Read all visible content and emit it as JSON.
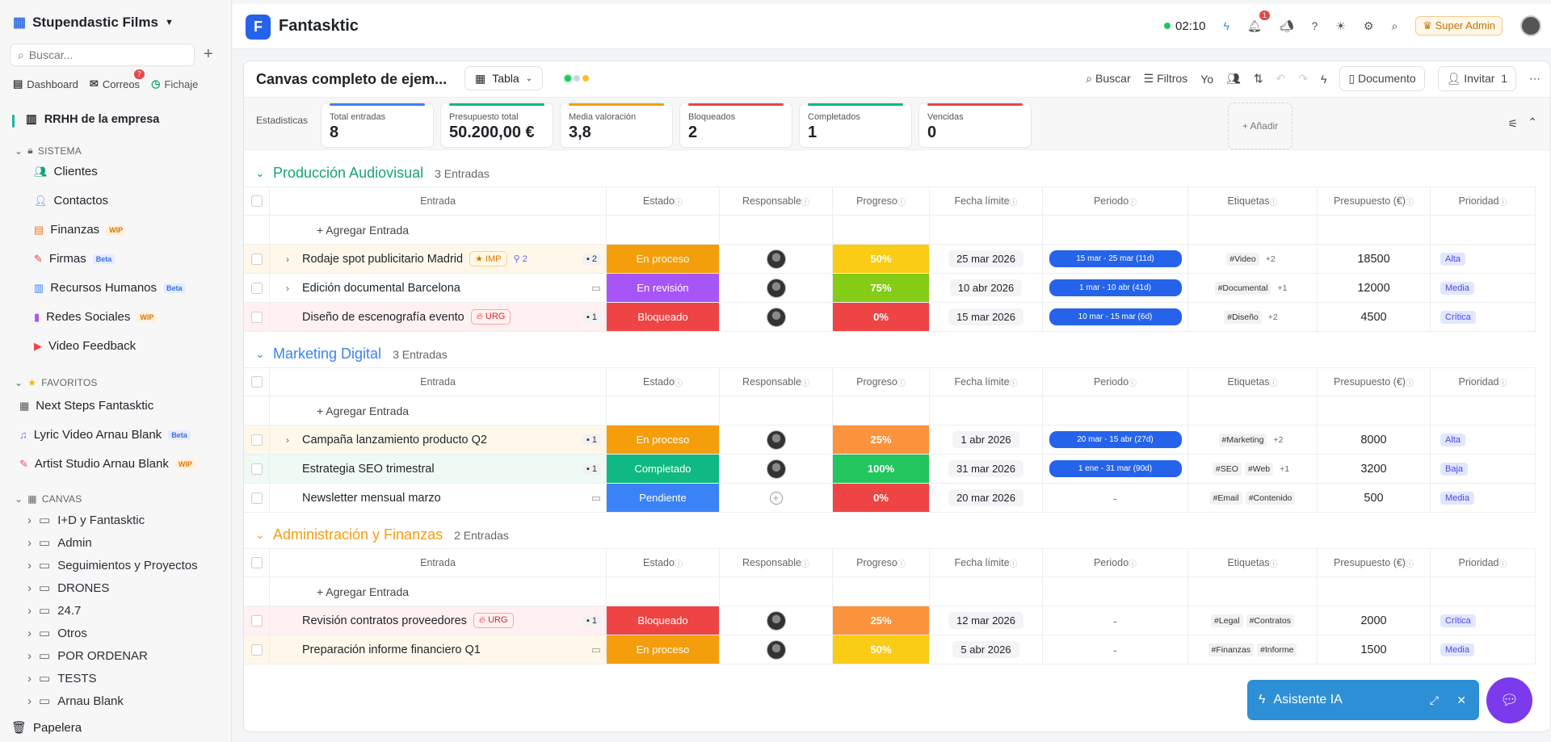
{
  "sidebar": {
    "workspace": "Stupendastic Films",
    "search_placeholder": "Buscar...",
    "quick": [
      "Dashboard",
      "Correos",
      "Fichaje"
    ],
    "correos_badge": "7",
    "current": "RRHH de la empresa",
    "sistema_label": "SISTEMA",
    "sistema": [
      {
        "label": "Clientes",
        "tag": ""
      },
      {
        "label": "Contactos",
        "tag": ""
      },
      {
        "label": "Finanzas",
        "tag": "WIP"
      },
      {
        "label": "Firmas",
        "tag": "Beta"
      },
      {
        "label": "Recursos Humanos",
        "tag": "Beta"
      },
      {
        "label": "Redes Sociales",
        "tag": "WIP"
      },
      {
        "label": "Video Feedback",
        "tag": ""
      }
    ],
    "favoritos_label": "FAVORITOS",
    "favoritos": [
      {
        "label": "Next Steps Fantasktic",
        "tag": ""
      },
      {
        "label": "Lyric Video Arnau Blank",
        "tag": "Beta"
      },
      {
        "label": "Artist Studio Arnau Blank",
        "tag": "WIP"
      }
    ],
    "canvas_label": "CANVAS",
    "canvas": [
      "I+D y Fantasktic",
      "Admin",
      "Seguimientos y Proyectos",
      "DRONES",
      "24.7",
      "Otros",
      "POR ORDENAR",
      "TESTS",
      "Arnau Blank"
    ],
    "trash": "Papelera"
  },
  "topbar": {
    "brand": "Fantasktic",
    "logo": "F",
    "timer": "02:10",
    "bell_badge": "1",
    "role": "Super Admin"
  },
  "panel": {
    "title": "Canvas completo de ejem...",
    "view": "Tabla",
    "tools": {
      "search": "Buscar",
      "filters": "Filtros",
      "me": "Yo",
      "document": "Documento",
      "invite": "Invitar",
      "invite_count": "1"
    }
  },
  "stats": {
    "label": "Estadisticas",
    "items": [
      {
        "label": "Total entradas",
        "value": "8",
        "color": "#3b82f6"
      },
      {
        "label": "Presupuesto total",
        "value": "50.200,00 €",
        "color": "#10b981"
      },
      {
        "label": "Media valoración",
        "value": "3,8",
        "color": "#f59e0b"
      },
      {
        "label": "Bloqueados",
        "value": "2",
        "color": "#ef4444"
      },
      {
        "label": "Completados",
        "value": "1",
        "color": "#10b981"
      },
      {
        "label": "Vencidas",
        "value": "0",
        "color": "#ef4444"
      }
    ],
    "add": "+ Añadir"
  },
  "columns": [
    "Entrada",
    "Estado",
    "Responsable",
    "Progreso",
    "Fecha límite",
    "Periodo",
    "Etiquetas",
    "Presupuesto (€)",
    "Prioridad"
  ],
  "add_entry": "+ Agregar Entrada",
  "groups": [
    {
      "name": "Producción Audiovisual",
      "count": "3 Entradas",
      "color": "#16a37b",
      "rows": [
        {
          "name": "Rodaje spot publicitario Madrid",
          "badge": "IMP",
          "sub": "2",
          "comments": "2",
          "expand": true,
          "bg": "#fff8ea",
          "estado": "En proceso",
          "ecolor": "#f59e0b",
          "resp": true,
          "prog": "50%",
          "pcolor": "#facc15",
          "fecha": "25 mar 2026",
          "periodo": "15 mar - 25 mar (11d)",
          "tags": [
            "#Video"
          ],
          "more": "+2",
          "pres": "18500",
          "pri": "Alta",
          "pribg": "#e0e7ff",
          "prifg": "#4f46e5"
        },
        {
          "name": "Edición documental Barcelona",
          "badge": "",
          "sub": "",
          "comments": "",
          "expand": true,
          "bg": "#fff",
          "estado": "En revisión",
          "ecolor": "#a855f7",
          "resp": true,
          "prog": "75%",
          "pcolor": "#84cc16",
          "fecha": "10 abr 2026",
          "periodo": "1 mar - 10 abr (41d)",
          "tags": [
            "#Documental"
          ],
          "more": "+1",
          "pres": "12000",
          "pri": "Media",
          "pribg": "#e0e7ff",
          "prifg": "#4f46e5"
        },
        {
          "name": "Diseño de escenografía evento",
          "badge": "URG",
          "sub": "",
          "comments": "1",
          "expand": false,
          "bg": "#fff1f1",
          "estado": "Bloqueado",
          "ecolor": "#ef4444",
          "resp": true,
          "prog": "0%",
          "pcolor": "#ef4444",
          "fecha": "15 mar 2026",
          "periodo": "10 mar - 15 mar (6d)",
          "tags": [
            "#Diseño"
          ],
          "more": "+2",
          "pres": "4500",
          "pri": "Crítica",
          "pribg": "#e0e7ff",
          "prifg": "#4f46e5"
        }
      ]
    },
    {
      "name": "Marketing Digital",
      "count": "3 Entradas",
      "color": "#3b82f6",
      "rows": [
        {
          "name": "Campaña lanzamiento producto Q2",
          "badge": "",
          "sub": "",
          "comments": "1",
          "expand": true,
          "bg": "#fff8ea",
          "estado": "En proceso",
          "ecolor": "#f59e0b",
          "resp": true,
          "prog": "25%",
          "pcolor": "#fb923c",
          "fecha": "1 abr 2026",
          "periodo": "20 mar - 15 abr (27d)",
          "tags": [
            "#Marketing"
          ],
          "more": "+2",
          "pres": "8000",
          "pri": "Alta",
          "pribg": "#e0e7ff",
          "prifg": "#4f46e5"
        },
        {
          "name": "Estrategia SEO trimestral",
          "badge": "",
          "sub": "",
          "comments": "1",
          "expand": false,
          "bg": "#eefaf3",
          "estado": "Completado",
          "ecolor": "#10b981",
          "resp": true,
          "prog": "100%",
          "pcolor": "#22c55e",
          "fecha": "31 mar 2026",
          "periodo": "1 ene - 31 mar (90d)",
          "tags": [
            "#SEO",
            "#Web"
          ],
          "more": "+1",
          "pres": "3200",
          "pri": "Baja",
          "pribg": "#e0e7ff",
          "prifg": "#4f46e5"
        },
        {
          "name": "Newsletter mensual marzo",
          "badge": "",
          "sub": "",
          "comments": "",
          "expand": false,
          "bg": "#fff",
          "estado": "Pendiente",
          "ecolor": "#3b82f6",
          "resp": false,
          "prog": "0%",
          "pcolor": "#ef4444",
          "fecha": "20 mar 2026",
          "periodo": "-",
          "tags": [
            "#Email",
            "#Contenido"
          ],
          "more": "",
          "pres": "500",
          "pri": "Media",
          "pribg": "#e0e7ff",
          "prifg": "#4f46e5"
        }
      ]
    },
    {
      "name": "Administración y Finanzas",
      "count": "2 Entradas",
      "color": "#f59e0b",
      "rows": [
        {
          "name": "Revisión contratos proveedores",
          "badge": "URG",
          "sub": "",
          "comments": "1",
          "expand": false,
          "bg": "#fff1f1",
          "estado": "Bloqueado",
          "ecolor": "#ef4444",
          "resp": true,
          "prog": "25%",
          "pcolor": "#fb923c",
          "fecha": "12 mar 2026",
          "periodo": "-",
          "tags": [
            "#Legal",
            "#Contratos"
          ],
          "more": "",
          "pres": "2000",
          "pri": "Crítica",
          "pribg": "#e0e7ff",
          "prifg": "#4f46e5"
        },
        {
          "name": "Preparación informe financiero Q1",
          "badge": "",
          "sub": "",
          "comments": "",
          "expand": false,
          "bg": "#fff8ea",
          "estado": "En proceso",
          "ecolor": "#f59e0b",
          "resp": true,
          "prog": "50%",
          "pcolor": "#facc15",
          "fecha": "5 abr 2026",
          "periodo": "-",
          "tags": [
            "#Finanzas",
            "#Informe"
          ],
          "more": "",
          "pres": "1500",
          "pri": "Media",
          "pribg": "#e0e7ff",
          "prifg": "#4f46e5"
        }
      ]
    }
  ],
  "assistant": {
    "label": "Asistente IA"
  }
}
